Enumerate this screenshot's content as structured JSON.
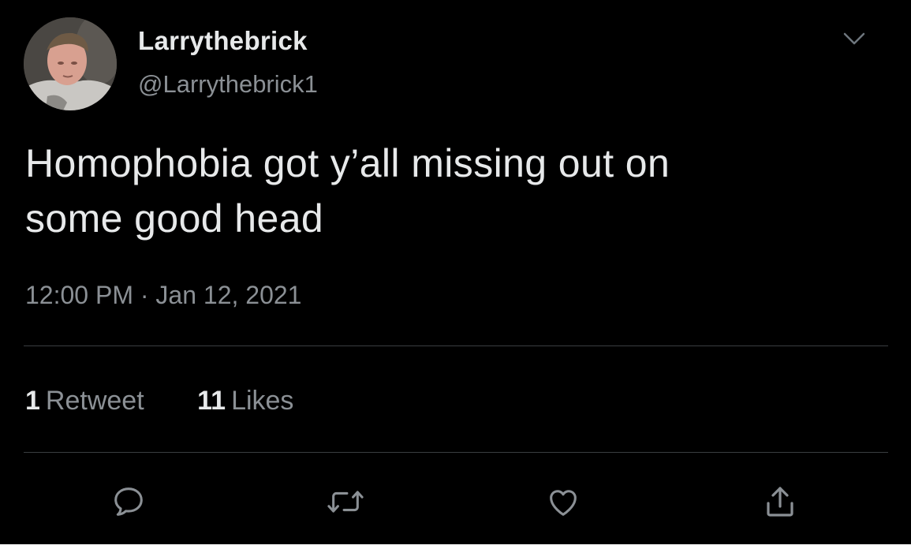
{
  "tweet": {
    "display_name": "Larrythebrick",
    "handle": "@Larrythebrick1",
    "text_line1": "Homophobia got y’all missing out on",
    "text_line2": "some good head",
    "timestamp": "12:00 PM · Jan 12, 2021"
  },
  "stats": {
    "retweets_count": "1",
    "retweets_label": "Retweet",
    "likes_count": "11",
    "likes_label": "Likes"
  },
  "actions": {
    "reply_icon": "comment-icon",
    "retweet_icon": "retweet-icon",
    "like_icon": "heart-icon",
    "share_icon": "share-icon"
  },
  "colors": {
    "background": "#000000",
    "primary_text": "#e7e9ea",
    "secondary_text": "#8b9095",
    "divider": "#3a3d40"
  }
}
